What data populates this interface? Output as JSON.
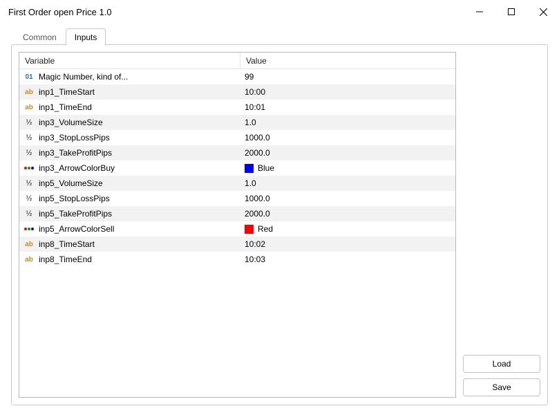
{
  "window": {
    "title": "First Order open Price  1.0"
  },
  "tabs": {
    "common": "Common",
    "inputs": "Inputs",
    "active": "inputs"
  },
  "table": {
    "header_variable": "Variable",
    "header_value": "Value",
    "rows": [
      {
        "type": "int",
        "type_label": "01",
        "name": "Magic Number, kind of...",
        "value": "99"
      },
      {
        "type": "string",
        "type_label": "ab",
        "name": "inp1_TimeStart",
        "value": "10:00"
      },
      {
        "type": "string",
        "type_label": "ab",
        "name": "inp1_TimeEnd",
        "value": "10:01"
      },
      {
        "type": "double",
        "type_label": "½",
        "name": "inp3_VolumeSize",
        "value": "1.0"
      },
      {
        "type": "double",
        "type_label": "½",
        "name": "inp3_StopLossPips",
        "value": "1000.0"
      },
      {
        "type": "double",
        "type_label": "½",
        "name": "inp3_TakeProfitPips",
        "value": "2000.0"
      },
      {
        "type": "color",
        "type_label": "",
        "name": "inp3_ArrowColorBuy",
        "value": "Blue",
        "swatch": "#0000ff"
      },
      {
        "type": "double",
        "type_label": "½",
        "name": "inp5_VolumeSize",
        "value": "1.0"
      },
      {
        "type": "double",
        "type_label": "½",
        "name": "inp5_StopLossPips",
        "value": "1000.0"
      },
      {
        "type": "double",
        "type_label": "½",
        "name": "inp5_TakeProfitPips",
        "value": "2000.0"
      },
      {
        "type": "color",
        "type_label": "",
        "name": "inp5_ArrowColorSell",
        "value": "Red",
        "swatch": "#ff0000"
      },
      {
        "type": "string",
        "type_label": "ab",
        "name": "inp8_TimeStart",
        "value": "10:02"
      },
      {
        "type": "string",
        "type_label": "ab",
        "name": "inp8_TimeEnd",
        "value": "10:03"
      }
    ]
  },
  "buttons": {
    "load": "Load",
    "save": "Save"
  }
}
